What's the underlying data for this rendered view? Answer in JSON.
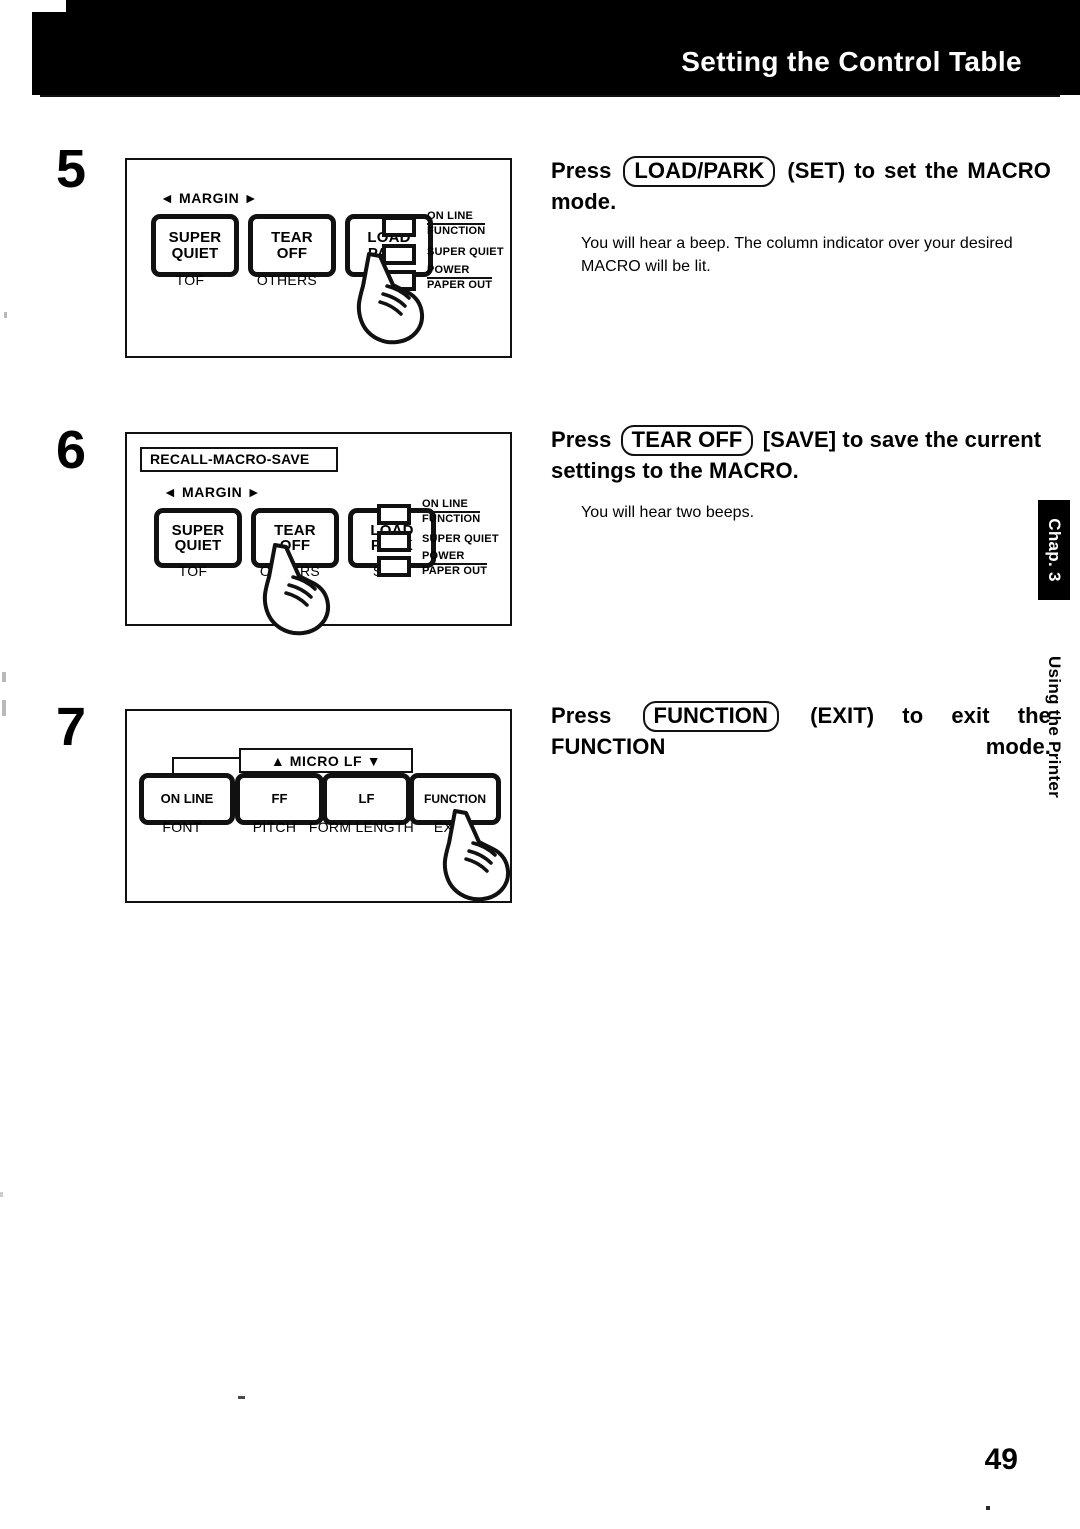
{
  "header": {
    "title": "Setting the Control Table"
  },
  "side_tab": {
    "chapter": "Chap. 3",
    "section": "Using the Printer"
  },
  "page_number": "49",
  "steps": [
    {
      "number": "5",
      "figure": {
        "recall_box": null,
        "margin_label": "◄ MARGIN ►",
        "keys": [
          {
            "line1": "SUPER",
            "line2": "QUIET",
            "sublabel": "TOF"
          },
          {
            "line1": "TEAR",
            "line2": "OFF",
            "sublabel": "OTHERS"
          },
          {
            "line1": "LOAD",
            "line2": "PARK",
            "sublabel": "SET"
          }
        ],
        "leds": [
          {
            "top": "ON LINE",
            "bottom": "FUNCTION"
          },
          {
            "top": null,
            "bottom": "SUPER QUIET"
          },
          {
            "top": "POWER",
            "bottom": "PAPER OUT"
          }
        ],
        "pressed_key": "LOAD PARK"
      },
      "heading_before": "Press",
      "heading_button": "LOAD/PARK",
      "heading_after": "(SET) to set the MACRO mode.",
      "body": "You will hear a beep. The column indicator over your desired MACRO will be lit."
    },
    {
      "number": "6",
      "figure": {
        "recall_box": "RECALL-MACRO-SAVE",
        "margin_label": "◄ MARGIN ►",
        "keys": [
          {
            "line1": "SUPER",
            "line2": "QUIET",
            "sublabel": "TOF"
          },
          {
            "line1": "TEAR",
            "line2": "OFF",
            "sublabel": "OTHERS"
          },
          {
            "line1": "LOAD",
            "line2": "PARK",
            "sublabel": "SET"
          }
        ],
        "leds": [
          {
            "top": "ON LINE",
            "bottom": "FUNCTION"
          },
          {
            "top": null,
            "bottom": "SUPER QUIET"
          },
          {
            "top": "POWER",
            "bottom": "PAPER OUT"
          }
        ],
        "pressed_key": "TEAR OFF"
      },
      "heading_before": "Press",
      "heading_button": "TEAR OFF",
      "heading_after": "[SAVE] to save the current settings to the MACRO.",
      "body": "You will hear two beeps."
    },
    {
      "number": "7",
      "figure": {
        "display": "▲ MICRO LF  ▼",
        "keys": [
          {
            "line1": "ON LINE",
            "sublabel": "FONT"
          },
          {
            "line1": "FF",
            "sublabel": "PITCH"
          },
          {
            "line1": "LF",
            "sublabel": "FORM LENGTH"
          },
          {
            "line1": "FUNCTION",
            "sublabel": "EXIT"
          }
        ],
        "pressed_key": "FUNCTION"
      },
      "heading_before": "Press",
      "heading_button": "FUNCTION",
      "heading_after": "(EXIT) to exit the FUNCTION mode.",
      "body": null
    }
  ]
}
